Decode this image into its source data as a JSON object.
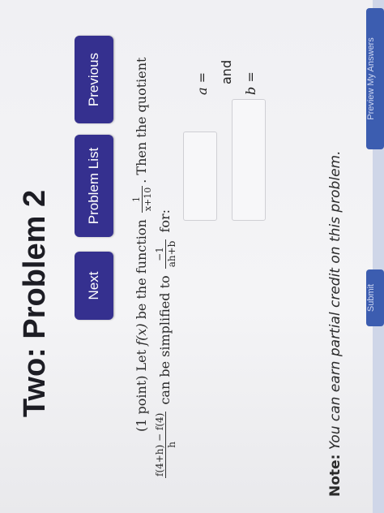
{
  "page": {
    "heading": "Two: Problem 2"
  },
  "nav": {
    "previous": "Previous",
    "problem_list": "Problem List",
    "next": "Next"
  },
  "problem": {
    "intro": "(1 point) Let ",
    "f_of_x": "f(x)",
    "be_function": " be the function ",
    "func_num": "1",
    "func_den": "x+10",
    "then_quotient": ". Then the quotient",
    "quot_num": "f(4+h) − f(4)",
    "quot_den": "h",
    "simplified": " can be simplified to ",
    "result_num": "−1",
    "result_den": "ah+b",
    "for_text": " for:"
  },
  "answers": {
    "a_label": "a =",
    "and_text": "and",
    "b_label": "b ="
  },
  "note": {
    "label": "Note:",
    "text": " You can earn partial credit on this problem."
  },
  "bottom_buttons": {
    "left": "Preview My Answers",
    "right": "Submit"
  },
  "colors": {
    "button_bg": "#35308f",
    "bottom_button_bg": "#3c5db0"
  }
}
